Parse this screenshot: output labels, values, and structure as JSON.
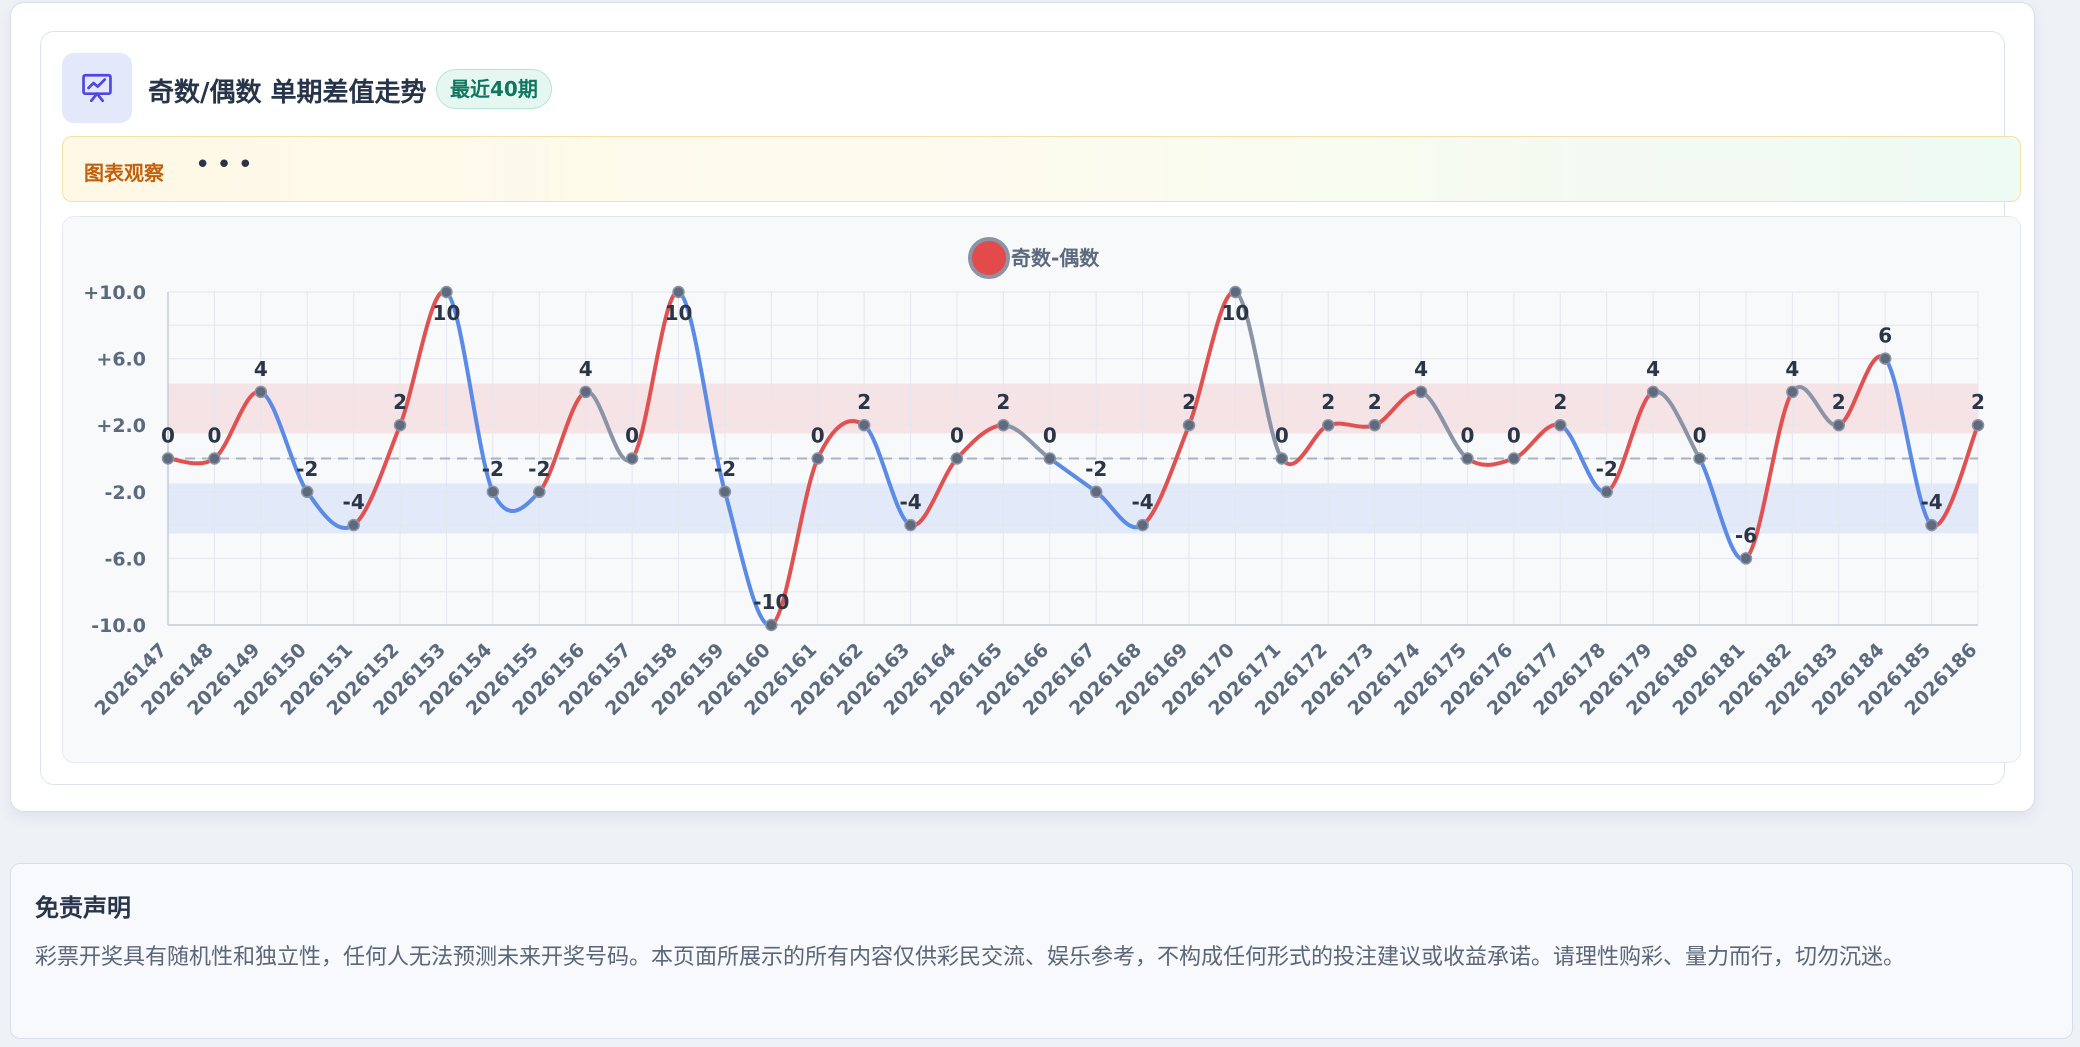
{
  "header": {
    "title": "奇数/偶数 单期差值走势",
    "badge": "最近40期",
    "icon": "presentation-chart-icon"
  },
  "notice": {
    "label": "图表观察",
    "dots": "•••"
  },
  "colors": {
    "positive": "#e05252",
    "negative": "#5b8be6",
    "neutral": "#8a94a6",
    "positive_band": "#f5e3e6",
    "negative_band": "#e2e9f8",
    "accent": "#4f46e5"
  },
  "chart_data": {
    "type": "line",
    "legend": "奇数-偶数",
    "legend_position": "top-center",
    "grid": true,
    "ylim": [
      -10,
      10
    ],
    "yticks": [
      "+10.0",
      "+6.0",
      "+2.0",
      "-2.0",
      "-6.0",
      "-10.0"
    ],
    "ytick_values": [
      10,
      6,
      2,
      -2,
      -6,
      -10
    ],
    "positive_band": [
      1.5,
      4.5
    ],
    "negative_band": [
      -4.5,
      -1.5
    ],
    "reference_line": 0,
    "categories": [
      "2026147",
      "2026148",
      "2026149",
      "2026150",
      "2026151",
      "2026152",
      "2026153",
      "2026154",
      "2026155",
      "2026156",
      "2026157",
      "2026158",
      "2026159",
      "2026160",
      "2026161",
      "2026162",
      "2026163",
      "2026164",
      "2026165",
      "2026166",
      "2026167",
      "2026168",
      "2026169",
      "2026170",
      "2026171",
      "2026172",
      "2026173",
      "2026174",
      "2026175",
      "2026176",
      "2026177",
      "2026178",
      "2026179",
      "2026180",
      "2026181",
      "2026182",
      "2026183",
      "2026184",
      "2026185",
      "2026186"
    ],
    "series": [
      {
        "name": "奇数-偶数",
        "values": [
          0,
          0,
          4,
          -2,
          -4,
          2,
          10,
          -2,
          -2,
          4,
          0,
          10,
          -2,
          -10,
          0,
          2,
          -4,
          0,
          2,
          0,
          -2,
          -4,
          2,
          10,
          0,
          2,
          2,
          4,
          0,
          0,
          2,
          -2,
          4,
          0,
          -6,
          4,
          2,
          6,
          -4,
          2
        ]
      }
    ]
  },
  "disclaimer": {
    "title": "免责声明",
    "body": "彩票开奖具有随机性和独立性，任何人无法预测未来开奖号码。本页面所展示的所有内容仅供彩民交流、娱乐参考，不构成任何形式的投注建议或收益承诺。请理性购彩、量力而行，切勿沉迷。"
  }
}
